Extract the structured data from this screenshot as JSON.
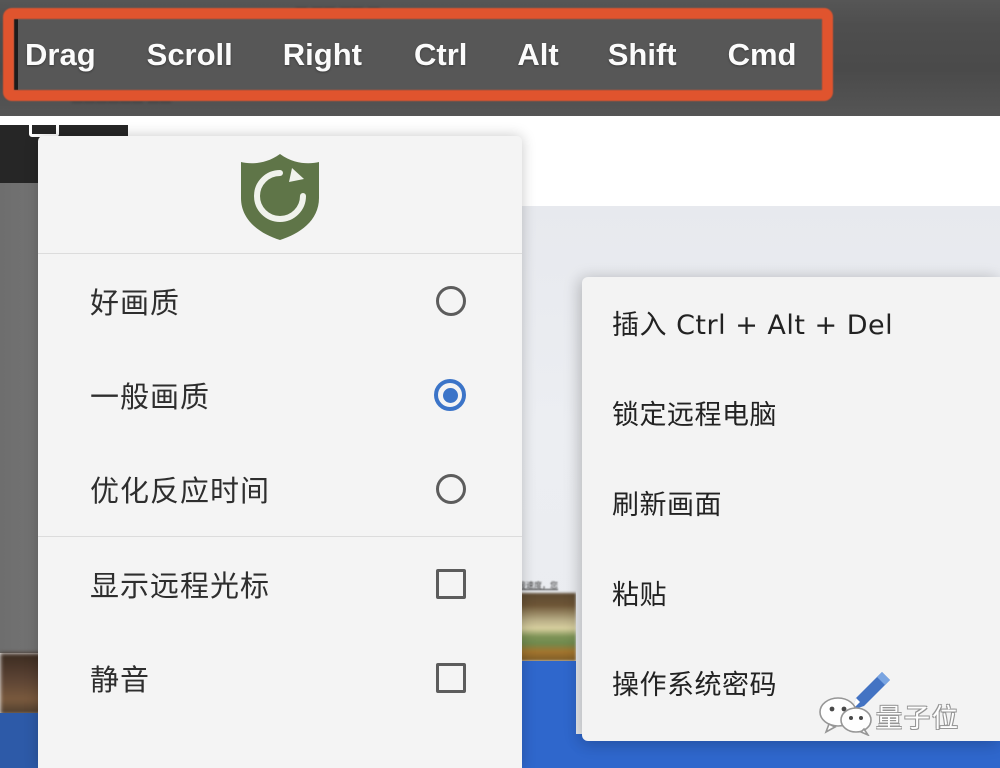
{
  "toolbar": {
    "name": "remote-control-toolbar",
    "ghost_top": "— —— —— —",
    "ghost_line1": "———— ——",
    "ghost_line2": "—————— ——",
    "highlight_color": "#e0542e",
    "background_color": "#575757",
    "keys": [
      {
        "label": "Drag"
      },
      {
        "label": "Scroll"
      },
      {
        "label": "Right"
      },
      {
        "label": "Ctrl"
      },
      {
        "label": "Alt"
      },
      {
        "label": "Shift"
      },
      {
        "label": "Cmd"
      }
    ]
  },
  "left_menu": {
    "title_icon": "shield-refresh-icon",
    "icon_color": "#5f7548",
    "accent_color": "#3b74c8",
    "quality_options": [
      {
        "label": "好画质",
        "control": "radio",
        "selected": false
      },
      {
        "label": "一般画质",
        "control": "radio",
        "selected": true
      },
      {
        "label": "优化反应时间",
        "control": "radio",
        "selected": false
      }
    ],
    "toggle_options": [
      {
        "label": "显示远程光标",
        "control": "checkbox",
        "checked": false
      },
      {
        "label": "静音",
        "control": "checkbox",
        "checked": false
      }
    ]
  },
  "right_menu": {
    "items": [
      {
        "label": "插入 Ctrl + Alt + Del"
      },
      {
        "label": "锁定远程电脑"
      },
      {
        "label": "刷新画面"
      },
      {
        "label": "粘贴"
      },
      {
        "label": "操作系统密码"
      }
    ]
  },
  "background": {
    "thumbnail_caption": "接速度，您",
    "bottom_bar_color": "#2f67cc",
    "screen_icon": "monitor-icon"
  },
  "watermark": {
    "text": "量子位",
    "pencil_icon": "pencil-icon",
    "wechat_icon": "wechat-icon",
    "pencil_color": "#3569c0"
  }
}
